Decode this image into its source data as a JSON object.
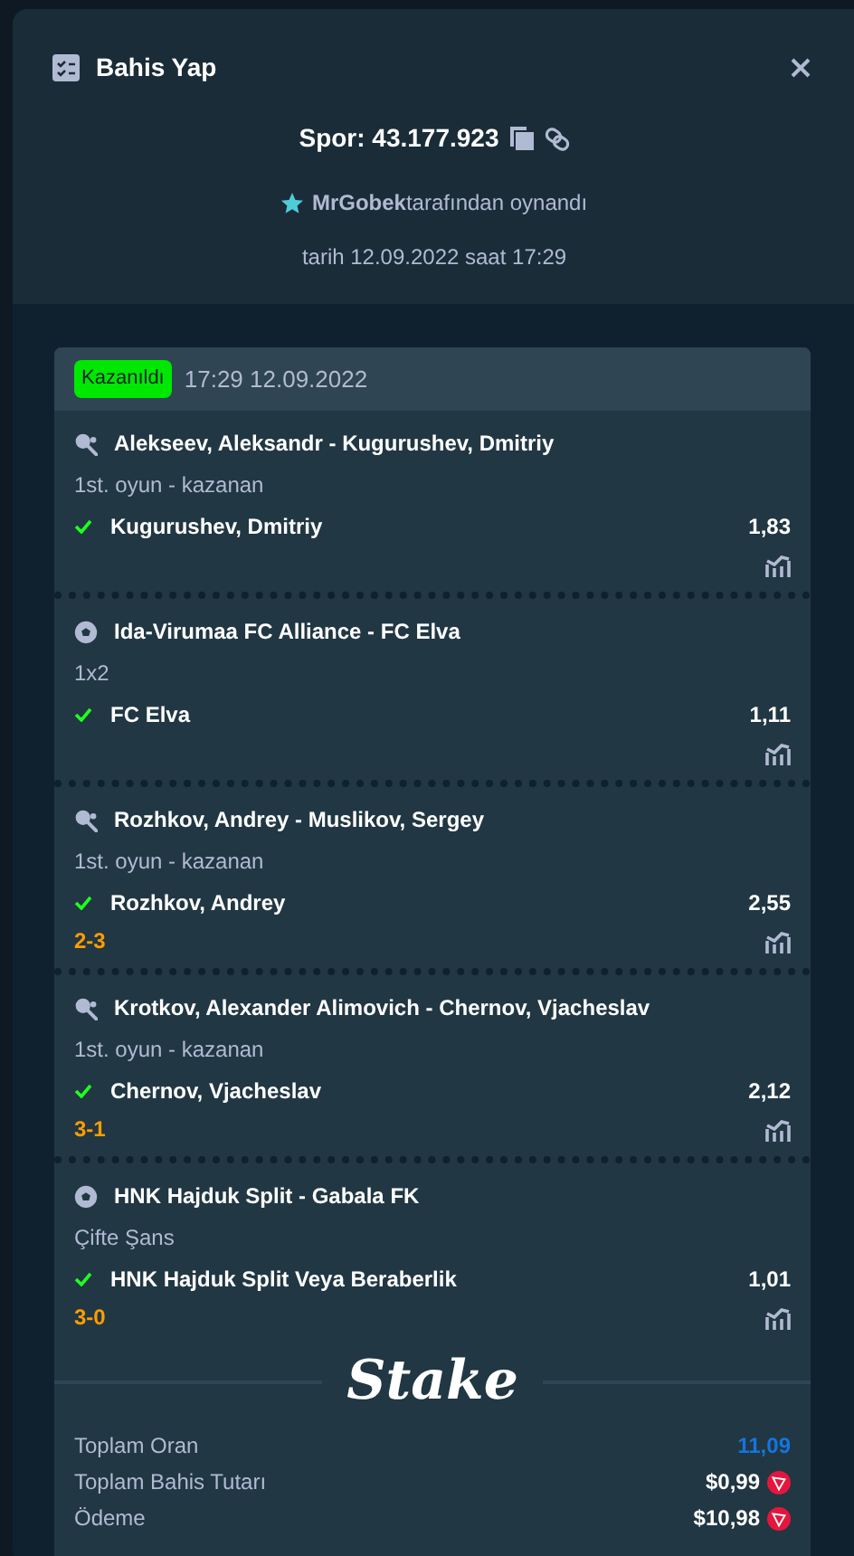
{
  "modal": {
    "title": "Bahis Yap",
    "bet_id": "Spor: 43.177.923",
    "player": "MrGobek",
    "played_by": "tarafından oynandı",
    "date": "tarih 12.09.2022 saat 17:29"
  },
  "slip": {
    "status": "Kazanıldı",
    "time": "17:29 12.09.2022",
    "legs": [
      {
        "kind": "tennis",
        "event": "Alekseev, Aleksandr - Kugurushev, Dmitriy",
        "market": "1st. oyun - kazanan",
        "selection": "Kugurushev, Dmitriy",
        "won": true,
        "odds": "1,83"
      },
      {
        "kind": "soccer",
        "event": "Ida-Virumaa FC Alliance - FC Elva",
        "market": "1x2",
        "selection": "FC Elva",
        "won": true,
        "odds": "1,11"
      },
      {
        "kind": "tennis",
        "event": "Rozhkov, Andrey - Muslikov, Sergey",
        "market": "1st. oyun - kazanan",
        "selection": "Rozhkov, Andrey",
        "won": true,
        "odds": "2,55",
        "score": "2-3"
      },
      {
        "kind": "tennis",
        "event": "Krotkov, Alexander Alimovich - Chernov, Vjacheslav",
        "market": "1st. oyun - kazanan",
        "selection": "Chernov, Vjacheslav",
        "won": true,
        "odds": "2,12",
        "score": "3-1"
      },
      {
        "kind": "soccer",
        "event": "HNK Hajduk Split - Gabala FK",
        "market": "Çifte Şans",
        "selection": "HNK Hajduk Split Veya Beraberlik",
        "won": true,
        "odds": "1,01",
        "score": "3-0"
      }
    ],
    "brand": "Stake",
    "totals": [
      {
        "label": "Toplam Oran",
        "value": "11,09",
        "kind": "odds"
      },
      {
        "label": "Toplam Bahis Tutarı",
        "value": "$0,99",
        "kind": "amount"
      },
      {
        "label": "Ödeme",
        "value": "$10,98",
        "kind": "amount"
      }
    ]
  }
}
